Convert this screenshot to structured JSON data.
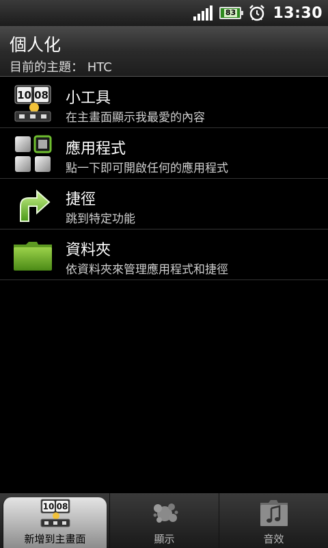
{
  "status": {
    "battery": "83",
    "time": "13:30",
    "icons": [
      "signal-icon",
      "battery-icon",
      "alarm-icon"
    ]
  },
  "header": {
    "title": "個人化",
    "theme_label": "目前的主題： HTC"
  },
  "items": [
    {
      "title": "小工具",
      "subtitle": "在主畫面顯示我最愛的內容",
      "icon": "widget-clock-icon",
      "widget_time": "10 08"
    },
    {
      "title": "應用程式",
      "subtitle": "點一下即可開啟任何的應用程式",
      "icon": "apps-grid-icon"
    },
    {
      "title": "捷徑",
      "subtitle": "跳到特定功能",
      "icon": "shortcut-arrow-icon"
    },
    {
      "title": "資料夾",
      "subtitle": "依資料夾來管理應用程式和捷徑",
      "icon": "folder-icon"
    }
  ],
  "tabs": [
    {
      "label": "新增到主畫面",
      "icon": "widget-clock-icon",
      "widget_time": "10 08",
      "active": true
    },
    {
      "label": "顯示",
      "icon": "paint-splash-icon",
      "active": false
    },
    {
      "label": "音效",
      "icon": "music-note-icon",
      "active": false
    }
  ],
  "colors": {
    "accent_green": "#6fbf2f",
    "background": "#000000"
  }
}
